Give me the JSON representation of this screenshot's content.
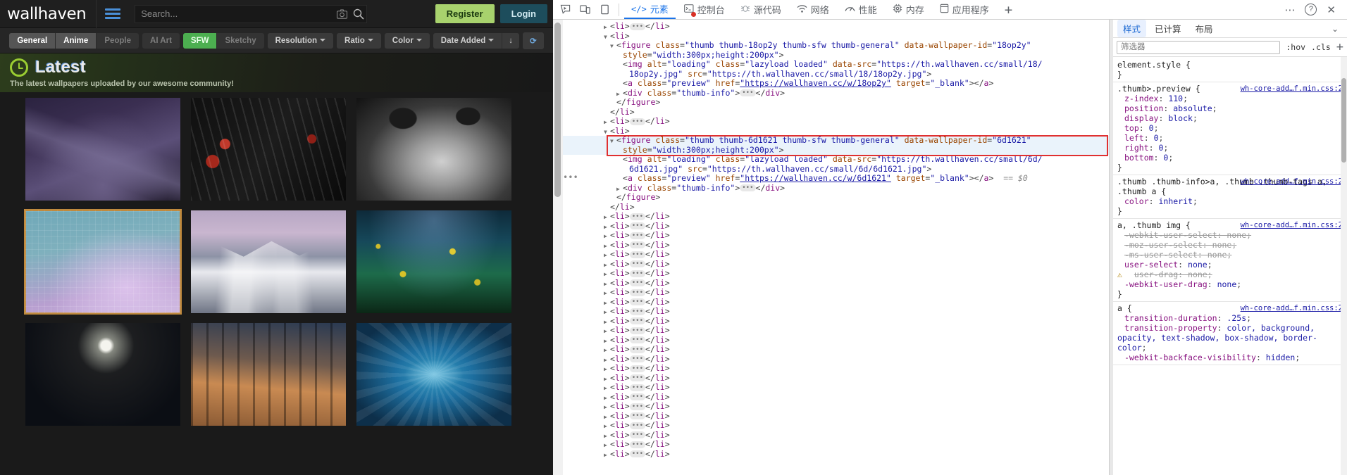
{
  "site": {
    "logo": "wallhaven",
    "search": {
      "placeholder": "Search...",
      "value": ""
    },
    "icons": {
      "menu": "hamburger-icon",
      "camera": "camera-icon",
      "magnifier": "search-icon"
    },
    "auth": {
      "register": "Register",
      "login": "Login"
    },
    "filters": {
      "categories": [
        {
          "label": "General",
          "state": "on"
        },
        {
          "label": "Anime",
          "state": "on"
        },
        {
          "label": "People",
          "state": "off"
        }
      ],
      "ai": [
        {
          "label": "AI Art",
          "state": "off"
        }
      ],
      "purity": [
        {
          "label": "SFW",
          "state": "sfw"
        },
        {
          "label": "Sketchy",
          "state": "sketchy"
        }
      ],
      "dropdowns": [
        {
          "label": "Resolution"
        },
        {
          "label": "Ratio"
        },
        {
          "label": "Color"
        },
        {
          "label": "Date Added"
        }
      ],
      "sort_direction": "↓",
      "refresh": "⟳"
    },
    "banner": {
      "icon": "clock-icon",
      "title": "Latest",
      "subtitle": "The latest wallpapers uploaded by our awesome community!"
    },
    "thumbs": [
      {
        "id": "t1",
        "selected": false
      },
      {
        "id": "t2",
        "selected": false
      },
      {
        "id": "t3",
        "selected": false
      },
      {
        "id": "t4",
        "selected": true
      },
      {
        "id": "t5",
        "selected": false
      },
      {
        "id": "t6",
        "selected": false
      },
      {
        "id": "t7",
        "selected": false
      },
      {
        "id": "t8",
        "selected": false
      },
      {
        "id": "t9",
        "selected": false
      }
    ]
  },
  "devtools": {
    "toolbar": {
      "inspect_icon": "inspect-cursor-icon",
      "device_icon": "device-toggle-icon",
      "dock_icon": "dock-side-icon",
      "tabs": [
        {
          "label": "元素",
          "icon": "code-icon",
          "active": true
        },
        {
          "label": "控制台",
          "icon": "console-icon",
          "badge": "error",
          "active": false
        },
        {
          "label": "源代码",
          "icon": "bug-icon",
          "active": false
        },
        {
          "label": "网络",
          "icon": "network-icon",
          "active": false
        },
        {
          "label": "性能",
          "icon": "performance-icon",
          "active": false
        },
        {
          "label": "内存",
          "icon": "memory-icon",
          "active": false
        },
        {
          "label": "应用程序",
          "icon": "application-icon",
          "active": false
        }
      ],
      "add_tab": "+",
      "more": "⋯",
      "help": "?",
      "close": "✕"
    },
    "dom_lines": [
      {
        "indent": 6,
        "tri": "▶",
        "html": "<span class=\"pn\">&lt;</span><span class=\"tw\">li</span><span class=\"pn\">&gt;</span><span class=\"ell\">•••</span><span class=\"pn\">&lt;/</span><span class=\"tw\">li</span><span class=\"pn\">&gt;</span>"
      },
      {
        "indent": 6,
        "tri": "▼",
        "html": "<span class=\"pn\">&lt;</span><span class=\"tw\">li</span><span class=\"pn\">&gt;</span>"
      },
      {
        "indent": 7,
        "tri": "▼",
        "html": "<span class=\"pn\">&lt;</span><span class=\"tw\">figure</span> <span class=\"at\">class</span>=<span class=\"av\">\"thumb thumb-18op2y thumb-sfw thumb-general\"</span> <span class=\"at\">data-wallpaper-id</span>=<span class=\"av\">\"18op2y\"</span>"
      },
      {
        "indent": 8,
        "tri": "",
        "html": "<span class=\"at\">style</span>=<span class=\"av\">\"width:300px;height:200px\"</span><span class=\"pn\">&gt;</span>"
      },
      {
        "indent": 8,
        "tri": "",
        "html": "<span class=\"pn\">&lt;</span><span class=\"tw\">img</span> <span class=\"at\">alt</span>=<span class=\"av\">\"loading\"</span> <span class=\"at\">class</span>=<span class=\"av\">\"lazyload loaded\"</span> <span class=\"at\">data-src</span>=<span class=\"av\">\"https://th.wallhaven.cc/small/18/</span>"
      },
      {
        "indent": 9,
        "tri": "",
        "html": "<span class=\"av\">18op2y.jpg\"</span> <span class=\"at\">src</span>=<span class=\"av\">\"https://th.wallhaven.cc/small/18/18op2y.jpg\"</span><span class=\"pn\">&gt;</span>"
      },
      {
        "indent": 8,
        "tri": "",
        "html": "<span class=\"pn\">&lt;</span><span class=\"tw\">a</span> <span class=\"at\">class</span>=<span class=\"av\">\"preview\"</span> <span class=\"at\">href</span>=<span class=\"lk\">\"https://wallhaven.cc/w/18op2y\"</span> <span class=\"at\">target</span>=<span class=\"av\">\"_blank\"</span><span class=\"pn\">&gt;&lt;/</span><span class=\"tw\">a</span><span class=\"pn\">&gt;</span>"
      },
      {
        "indent": 8,
        "tri": "▶",
        "html": "<span class=\"pn\">&lt;</span><span class=\"tw\">div</span> <span class=\"at\">class</span>=<span class=\"av\">\"thumb-info\"</span><span class=\"pn\">&gt;</span><span class=\"ell\">•••</span><span class=\"pn\">&lt;/</span><span class=\"tw\">div</span><span class=\"pn\">&gt;</span>"
      },
      {
        "indent": 7,
        "tri": "",
        "html": "<span class=\"pn\">&lt;/</span><span class=\"tw\">figure</span><span class=\"pn\">&gt;</span>"
      },
      {
        "indent": 6,
        "tri": "",
        "html": "<span class=\"pn\">&lt;/</span><span class=\"tw\">li</span><span class=\"pn\">&gt;</span>"
      },
      {
        "indent": 6,
        "tri": "▶",
        "html": "<span class=\"pn\">&lt;</span><span class=\"tw\">li</span><span class=\"pn\">&gt;</span><span class=\"ell\">•••</span><span class=\"pn\">&lt;/</span><span class=\"tw\">li</span><span class=\"pn\">&gt;</span>"
      },
      {
        "indent": 6,
        "tri": "▼",
        "html": "<span class=\"pn\">&lt;</span><span class=\"tw\">li</span><span class=\"pn\">&gt;</span>"
      },
      {
        "indent": 7,
        "tri": "▼",
        "hl": true,
        "html": "<span class=\"pn\">&lt;</span><span class=\"tw\">figure</span> <span class=\"at\">class</span>=<span class=\"av\">\"thumb thumb-6d1621 thumb-sfw thumb-general\"</span> <span class=\"at\">data-wallpaper-id</span>=<span class=\"av\">\"6d1621\"</span>"
      },
      {
        "indent": 8,
        "tri": "",
        "hl": true,
        "html": "<span class=\"at\">style</span>=<span class=\"av\">\"width:300px;height:200px\"</span><span class=\"pn\">&gt;</span>"
      },
      {
        "indent": 8,
        "tri": "",
        "html": "<span class=\"pn\">&lt;</span><span class=\"tw\">img</span> <span class=\"at\">alt</span>=<span class=\"av\">\"loading\"</span> <span class=\"at\">class</span>=<span class=\"av\">\"lazyload loaded\"</span> <span class=\"at\">data-src</span>=<span class=\"av\">\"https://th.wallhaven.cc/small/6d/</span>"
      },
      {
        "indent": 9,
        "tri": "",
        "html": "<span class=\"av\">6d1621.jpg\"</span> <span class=\"at\">src</span>=<span class=\"av\">\"https://th.wallhaven.cc/small/6d/6d1621.jpg\"</span><span class=\"pn\">&gt;</span>"
      },
      {
        "indent": 8,
        "tri": "",
        "dots": true,
        "html": "<span class=\"pn\">&lt;</span><span class=\"tw\">a</span> <span class=\"at\">class</span>=<span class=\"av\">\"preview\"</span> <span class=\"at\">href</span>=<span class=\"lk\">\"https://wallhaven.cc/w/6d1621\"</span> <span class=\"at\">target</span>=<span class=\"av\">\"_blank\"</span><span class=\"pn\">&gt;&lt;/</span><span class=\"tw\">a</span><span class=\"pn\">&gt;</span>  <span class=\"sel-badge\">== $0</span>"
      },
      {
        "indent": 8,
        "tri": "▶",
        "html": "<span class=\"pn\">&lt;</span><span class=\"tw\">div</span> <span class=\"at\">class</span>=<span class=\"av\">\"thumb-info\"</span><span class=\"pn\">&gt;</span><span class=\"ell\">•••</span><span class=\"pn\">&lt;/</span><span class=\"tw\">div</span><span class=\"pn\">&gt;</span>"
      },
      {
        "indent": 7,
        "tri": "",
        "html": "<span class=\"pn\">&lt;/</span><span class=\"tw\">figure</span><span class=\"pn\">&gt;</span>"
      },
      {
        "indent": 6,
        "tri": "",
        "html": "<span class=\"pn\">&lt;/</span><span class=\"tw\">li</span><span class=\"pn\">&gt;</span>"
      },
      {
        "indent": 6,
        "tri": "▶",
        "html": "<span class=\"pn\">&lt;</span><span class=\"tw\">li</span><span class=\"pn\">&gt;</span><span class=\"ell\">•••</span><span class=\"pn\">&lt;/</span><span class=\"tw\">li</span><span class=\"pn\">&gt;</span>"
      },
      {
        "indent": 6,
        "tri": "▶",
        "html": "<span class=\"pn\">&lt;</span><span class=\"tw\">li</span><span class=\"pn\">&gt;</span><span class=\"ell\">•••</span><span class=\"pn\">&lt;/</span><span class=\"tw\">li</span><span class=\"pn\">&gt;</span>"
      },
      {
        "indent": 6,
        "tri": "▶",
        "html": "<span class=\"pn\">&lt;</span><span class=\"tw\">li</span><span class=\"pn\">&gt;</span><span class=\"ell\">•••</span><span class=\"pn\">&lt;/</span><span class=\"tw\">li</span><span class=\"pn\">&gt;</span>"
      },
      {
        "indent": 6,
        "tri": "▶",
        "html": "<span class=\"pn\">&lt;</span><span class=\"tw\">li</span><span class=\"pn\">&gt;</span><span class=\"ell\">•••</span><span class=\"pn\">&lt;/</span><span class=\"tw\">li</span><span class=\"pn\">&gt;</span>"
      },
      {
        "indent": 6,
        "tri": "▶",
        "html": "<span class=\"pn\">&lt;</span><span class=\"tw\">li</span><span class=\"pn\">&gt;</span><span class=\"ell\">•••</span><span class=\"pn\">&lt;/</span><span class=\"tw\">li</span><span class=\"pn\">&gt;</span>"
      },
      {
        "indent": 6,
        "tri": "▶",
        "html": "<span class=\"pn\">&lt;</span><span class=\"tw\">li</span><span class=\"pn\">&gt;</span><span class=\"ell\">•••</span><span class=\"pn\">&lt;/</span><span class=\"tw\">li</span><span class=\"pn\">&gt;</span>"
      },
      {
        "indent": 6,
        "tri": "▶",
        "html": "<span class=\"pn\">&lt;</span><span class=\"tw\">li</span><span class=\"pn\">&gt;</span><span class=\"ell\">•••</span><span class=\"pn\">&lt;/</span><span class=\"tw\">li</span><span class=\"pn\">&gt;</span>"
      },
      {
        "indent": 6,
        "tri": "▶",
        "html": "<span class=\"pn\">&lt;</span><span class=\"tw\">li</span><span class=\"pn\">&gt;</span><span class=\"ell\">•••</span><span class=\"pn\">&lt;/</span><span class=\"tw\">li</span><span class=\"pn\">&gt;</span>"
      },
      {
        "indent": 6,
        "tri": "▶",
        "html": "<span class=\"pn\">&lt;</span><span class=\"tw\">li</span><span class=\"pn\">&gt;</span><span class=\"ell\">•••</span><span class=\"pn\">&lt;/</span><span class=\"tw\">li</span><span class=\"pn\">&gt;</span>"
      },
      {
        "indent": 6,
        "tri": "▶",
        "html": "<span class=\"pn\">&lt;</span><span class=\"tw\">li</span><span class=\"pn\">&gt;</span><span class=\"ell\">•••</span><span class=\"pn\">&lt;/</span><span class=\"tw\">li</span><span class=\"pn\">&gt;</span>"
      },
      {
        "indent": 6,
        "tri": "▶",
        "html": "<span class=\"pn\">&lt;</span><span class=\"tw\">li</span><span class=\"pn\">&gt;</span><span class=\"ell\">•••</span><span class=\"pn\">&lt;/</span><span class=\"tw\">li</span><span class=\"pn\">&gt;</span>"
      },
      {
        "indent": 6,
        "tri": "▶",
        "html": "<span class=\"pn\">&lt;</span><span class=\"tw\">li</span><span class=\"pn\">&gt;</span><span class=\"ell\">•••</span><span class=\"pn\">&lt;/</span><span class=\"tw\">li</span><span class=\"pn\">&gt;</span>"
      },
      {
        "indent": 6,
        "tri": "▶",
        "html": "<span class=\"pn\">&lt;</span><span class=\"tw\">li</span><span class=\"pn\">&gt;</span><span class=\"ell\">•••</span><span class=\"pn\">&lt;/</span><span class=\"tw\">li</span><span class=\"pn\">&gt;</span>"
      },
      {
        "indent": 6,
        "tri": "▶",
        "html": "<span class=\"pn\">&lt;</span><span class=\"tw\">li</span><span class=\"pn\">&gt;</span><span class=\"ell\">•••</span><span class=\"pn\">&lt;/</span><span class=\"tw\">li</span><span class=\"pn\">&gt;</span>"
      },
      {
        "indent": 6,
        "tri": "▶",
        "html": "<span class=\"pn\">&lt;</span><span class=\"tw\">li</span><span class=\"pn\">&gt;</span><span class=\"ell\">•••</span><span class=\"pn\">&lt;/</span><span class=\"tw\">li</span><span class=\"pn\">&gt;</span>"
      },
      {
        "indent": 6,
        "tri": "▶",
        "html": "<span class=\"pn\">&lt;</span><span class=\"tw\">li</span><span class=\"pn\">&gt;</span><span class=\"ell\">•••</span><span class=\"pn\">&lt;/</span><span class=\"tw\">li</span><span class=\"pn\">&gt;</span>"
      },
      {
        "indent": 6,
        "tri": "▶",
        "html": "<span class=\"pn\">&lt;</span><span class=\"tw\">li</span><span class=\"pn\">&gt;</span><span class=\"ell\">•••</span><span class=\"pn\">&lt;/</span><span class=\"tw\">li</span><span class=\"pn\">&gt;</span>"
      },
      {
        "indent": 6,
        "tri": "▶",
        "html": "<span class=\"pn\">&lt;</span><span class=\"tw\">li</span><span class=\"pn\">&gt;</span><span class=\"ell\">•••</span><span class=\"pn\">&lt;/</span><span class=\"tw\">li</span><span class=\"pn\">&gt;</span>"
      },
      {
        "indent": 6,
        "tri": "▶",
        "html": "<span class=\"pn\">&lt;</span><span class=\"tw\">li</span><span class=\"pn\">&gt;</span><span class=\"ell\">•••</span><span class=\"pn\">&lt;/</span><span class=\"tw\">li</span><span class=\"pn\">&gt;</span>"
      },
      {
        "indent": 6,
        "tri": "▶",
        "html": "<span class=\"pn\">&lt;</span><span class=\"tw\">li</span><span class=\"pn\">&gt;</span><span class=\"ell\">•••</span><span class=\"pn\">&lt;/</span><span class=\"tw\">li</span><span class=\"pn\">&gt;</span>"
      },
      {
        "indent": 6,
        "tri": "▶",
        "html": "<span class=\"pn\">&lt;</span><span class=\"tw\">li</span><span class=\"pn\">&gt;</span><span class=\"ell\">•••</span><span class=\"pn\">&lt;/</span><span class=\"tw\">li</span><span class=\"pn\">&gt;</span>"
      },
      {
        "indent": 6,
        "tri": "▶",
        "html": "<span class=\"pn\">&lt;</span><span class=\"tw\">li</span><span class=\"pn\">&gt;</span><span class=\"ell\">•••</span><span class=\"pn\">&lt;/</span><span class=\"tw\">li</span><span class=\"pn\">&gt;</span>"
      },
      {
        "indent": 6,
        "tri": "▶",
        "html": "<span class=\"pn\">&lt;</span><span class=\"tw\">li</span><span class=\"pn\">&gt;</span><span class=\"ell\">•••</span><span class=\"pn\">&lt;/</span><span class=\"tw\">li</span><span class=\"pn\">&gt;</span>"
      },
      {
        "indent": 6,
        "tri": "▶",
        "html": "<span class=\"pn\">&lt;</span><span class=\"tw\">li</span><span class=\"pn\">&gt;</span><span class=\"ell\">•••</span><span class=\"pn\">&lt;/</span><span class=\"tw\">li</span><span class=\"pn\">&gt;</span>"
      },
      {
        "indent": 6,
        "tri": "▶",
        "html": "<span class=\"pn\">&lt;</span><span class=\"tw\">li</span><span class=\"pn\">&gt;</span><span class=\"ell\">•••</span><span class=\"pn\">&lt;/</span><span class=\"tw\">li</span><span class=\"pn\">&gt;</span>"
      },
      {
        "indent": 6,
        "tri": "▶",
        "html": "<span class=\"pn\">&lt;</span><span class=\"tw\">li</span><span class=\"pn\">&gt;</span><span class=\"ell\">•••</span><span class=\"pn\">&lt;/</span><span class=\"tw\">li</span><span class=\"pn\">&gt;</span>"
      }
    ],
    "styles": {
      "tabs": [
        {
          "label": "样式",
          "active": true
        },
        {
          "label": "已计算",
          "active": false
        },
        {
          "label": "布局",
          "active": false
        }
      ],
      "filter_placeholder": "筛选器",
      "filter_value": "",
      "hov": ":hov",
      "cls": ".cls",
      "new_rule": "+",
      "rules": [
        {
          "selector": "element.style {",
          "close": "}",
          "source": "",
          "declarations": []
        },
        {
          "selector": ".thumb>.preview {",
          "close": "}",
          "source": "wh-core-add…f.min.css:2",
          "declarations": [
            {
              "prop": "z-index",
              "value": "110"
            },
            {
              "prop": "position",
              "value": "absolute"
            },
            {
              "prop": "display",
              "value": "block"
            },
            {
              "prop": "top",
              "value": "0"
            },
            {
              "prop": "left",
              "value": "0"
            },
            {
              "prop": "right",
              "value": "0"
            },
            {
              "prop": "bottom",
              "value": "0"
            }
          ]
        },
        {
          "selector": ".thumb .thumb-info>a, .thumb .thumb-tags a, .thumb a {",
          "close": "}",
          "source": "wh-core-add…f.min.css:2",
          "declarations": [
            {
              "prop": "color",
              "value": "inherit"
            }
          ]
        },
        {
          "selector": "a, .thumb img {",
          "close": "}",
          "source": "wh-core-add…f.min.css:2",
          "declarations": [
            {
              "prop": "-webkit-user-select",
              "value": "none",
              "strike": true
            },
            {
              "prop": "-moz-user-select",
              "value": "none",
              "strike": true
            },
            {
              "prop": "-ms-user-select",
              "value": "none",
              "strike": true
            },
            {
              "prop": "user-select",
              "value": "none"
            },
            {
              "prop": "user-drag",
              "value": "none",
              "strike": true,
              "warn": true
            },
            {
              "prop": "-webkit-user-drag",
              "value": "none"
            }
          ]
        },
        {
          "selector": "a {",
          "close": "",
          "source": "wh-core-add…f.min.css:2",
          "declarations": [
            {
              "prop": "transition-duration",
              "value": ".25s"
            },
            {
              "prop": "transition-property",
              "value": "color, background, opacity, text-shadow, box-shadow, border-color"
            },
            {
              "prop": "-webkit-backface-visibility",
              "value": "hidden"
            }
          ]
        }
      ]
    }
  }
}
